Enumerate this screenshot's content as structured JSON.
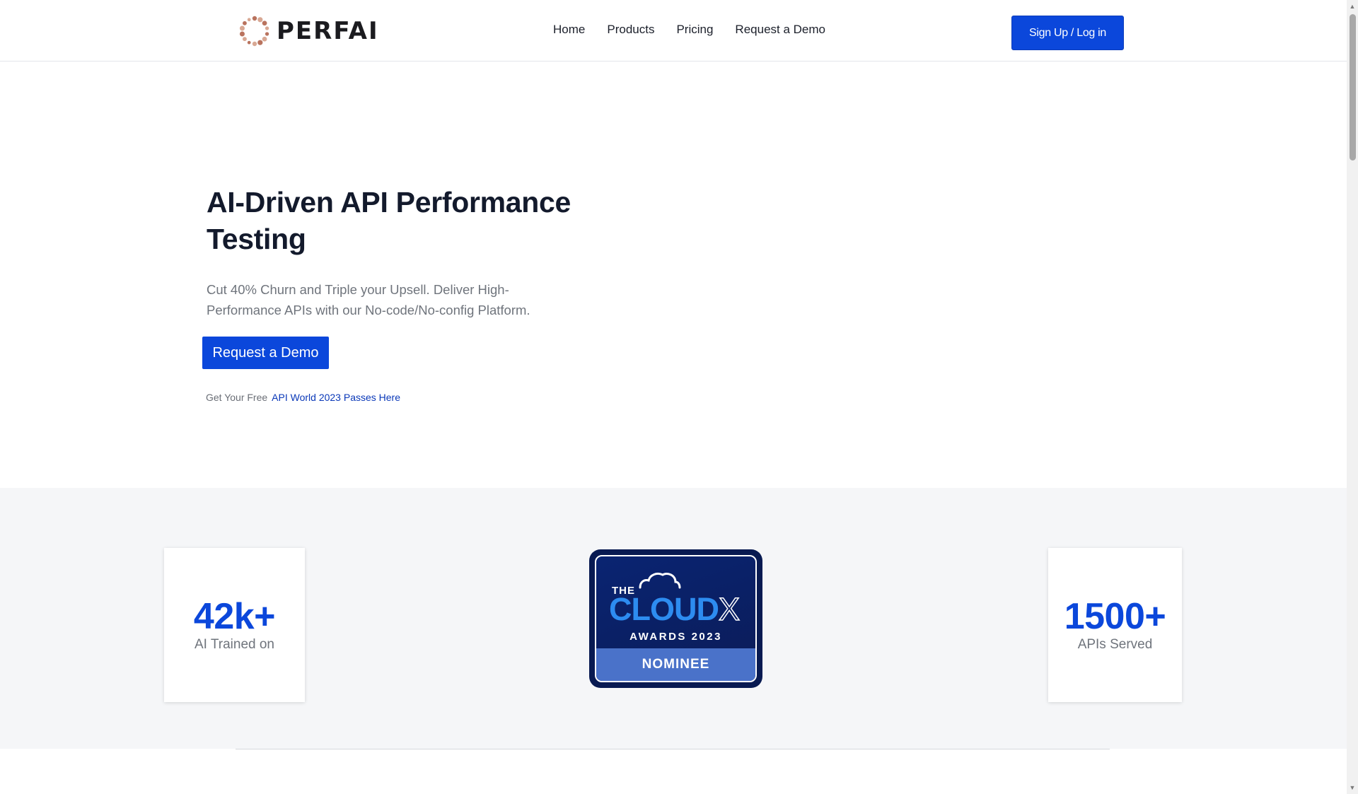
{
  "header": {
    "logo_text": "PERFAI",
    "nav": [
      {
        "label": "Home"
      },
      {
        "label": "Products"
      },
      {
        "label": "Pricing"
      },
      {
        "label": "Request a Demo"
      }
    ],
    "signup_label": "Sign Up / Log in"
  },
  "hero": {
    "title": "AI-Driven API Performance Testing",
    "subtitle": "Cut 40% Churn and Triple your Upsell. Deliver High-Performance APIs with our No-code/No-config Platform.",
    "cta_label": "Request a Demo",
    "free_prefix": "Get Your Free",
    "free_link": "API World 2023 Passes Here"
  },
  "stats": {
    "left": {
      "value": "42k+",
      "label": "AI Trained on"
    },
    "right": {
      "value": "1500+",
      "label": "APIs Served"
    }
  },
  "badge": {
    "the": "THE",
    "cloud": "CLOUD",
    "x": "X",
    "awards": "AWARDS 2023",
    "nominee": "NOMINEE"
  },
  "colors": {
    "accent": "#0b47db",
    "link": "#0a38b8",
    "band_background": "#f5f6f8",
    "badge_navy": "#081a52",
    "badge_nominee": "#4a72c9"
  },
  "icons": {
    "logo": "dotted-ring-logo-icon"
  }
}
